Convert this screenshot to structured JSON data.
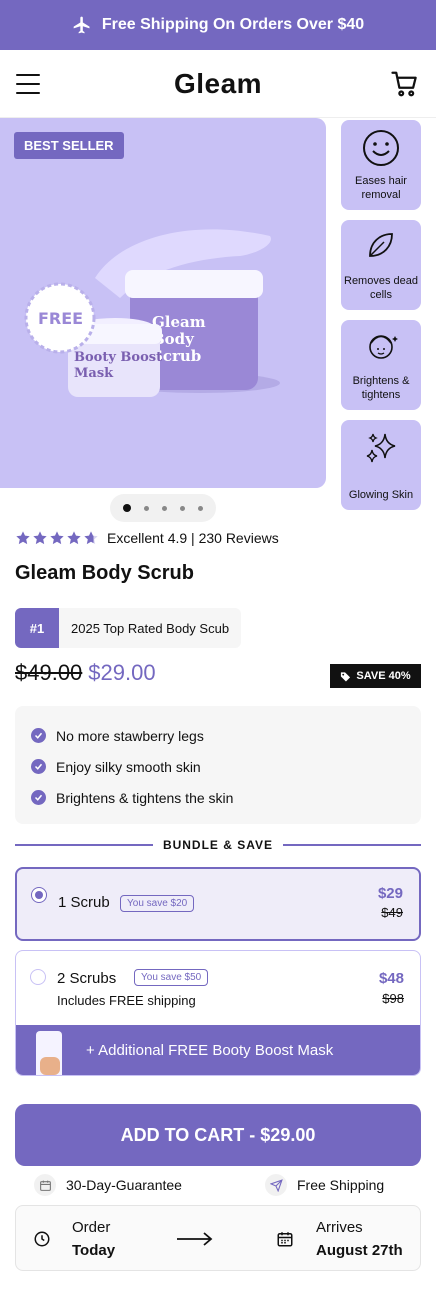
{
  "announcement": {
    "text": "Free Shipping On Orders Over $40"
  },
  "header": {
    "logo": "Gleam"
  },
  "hero": {
    "badge": "BEST SELLER",
    "product_labels": {
      "mask_line1": "Booty Boost",
      "mask_line2": "Mask",
      "scrub_line1": "Gleam",
      "scrub_line2": "Body",
      "scrub_line3": "Scrub",
      "free_seal": "FREE"
    },
    "carousel": {
      "slides": 5,
      "active": 1
    }
  },
  "features": [
    {
      "label": "Eases hair removal",
      "icon": "smile-icon"
    },
    {
      "label": "Removes dead cells",
      "icon": "leaf-icon"
    },
    {
      "label": "Brightens & tightens",
      "icon": "face-icon"
    },
    {
      "label": "Glowing Skin",
      "icon": "sparkle-icon"
    }
  ],
  "rating": {
    "stars": 4.9,
    "text": "Excellent 4.9 | 230 Reviews"
  },
  "product": {
    "title": "Gleam Body Scrub"
  },
  "rank": {
    "number": "#1",
    "text": "2025 Top Rated Body Scub"
  },
  "price": {
    "old": "$49.00",
    "new": "$29.00",
    "save_badge": "SAVE 40%"
  },
  "benefits": [
    "No more stawberry legs",
    "Enjoy silky smooth skin",
    "Brightens & tightens the skin"
  ],
  "bundle": {
    "title": "BUNDLE & SAVE",
    "options": [
      {
        "name": "1 Scrub",
        "pill": "You save $20",
        "price": "$29",
        "old_price": "$49",
        "selected": true
      },
      {
        "name": "2 Scrubs",
        "pill": "You save $50",
        "sub": "Includes FREE shipping",
        "price": "$48",
        "old_price": "$98",
        "bonus": "+ Additional FREE Booty Boost Mask",
        "selected": false
      }
    ]
  },
  "cta": {
    "label": "ADD TO CART - $29.00"
  },
  "trust": [
    {
      "label": "30-Day-Guarantee",
      "icon": "calendar-icon"
    },
    {
      "label": "Free Shipping",
      "icon": "send-icon"
    }
  ],
  "delivery": {
    "order_label": "Order",
    "order_value": "Today",
    "arrive_label": "Arrives",
    "arrive_value": "August 27th"
  },
  "colors": {
    "accent": "#7468c0",
    "lavender": "#c8c1f5"
  }
}
